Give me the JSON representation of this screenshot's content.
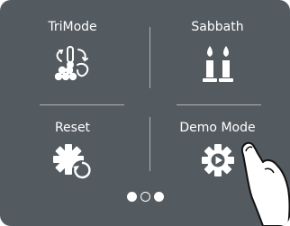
{
  "menu": {
    "tiles": [
      {
        "label": "TriMode",
        "icon": "trimode-icon"
      },
      {
        "label": "Sabbath",
        "icon": "candles-icon"
      },
      {
        "label": "Reset",
        "icon": "reset-gear-icon"
      },
      {
        "label": "Demo Mode",
        "icon": "play-gear-icon"
      }
    ]
  },
  "pagination": {
    "count": 3,
    "active_index": 1
  },
  "colors": {
    "panel": "#545b60",
    "foreground": "#ffffff",
    "divider": "#aeb3b6"
  },
  "overlay": {
    "icon": "pointing-hand-icon"
  }
}
